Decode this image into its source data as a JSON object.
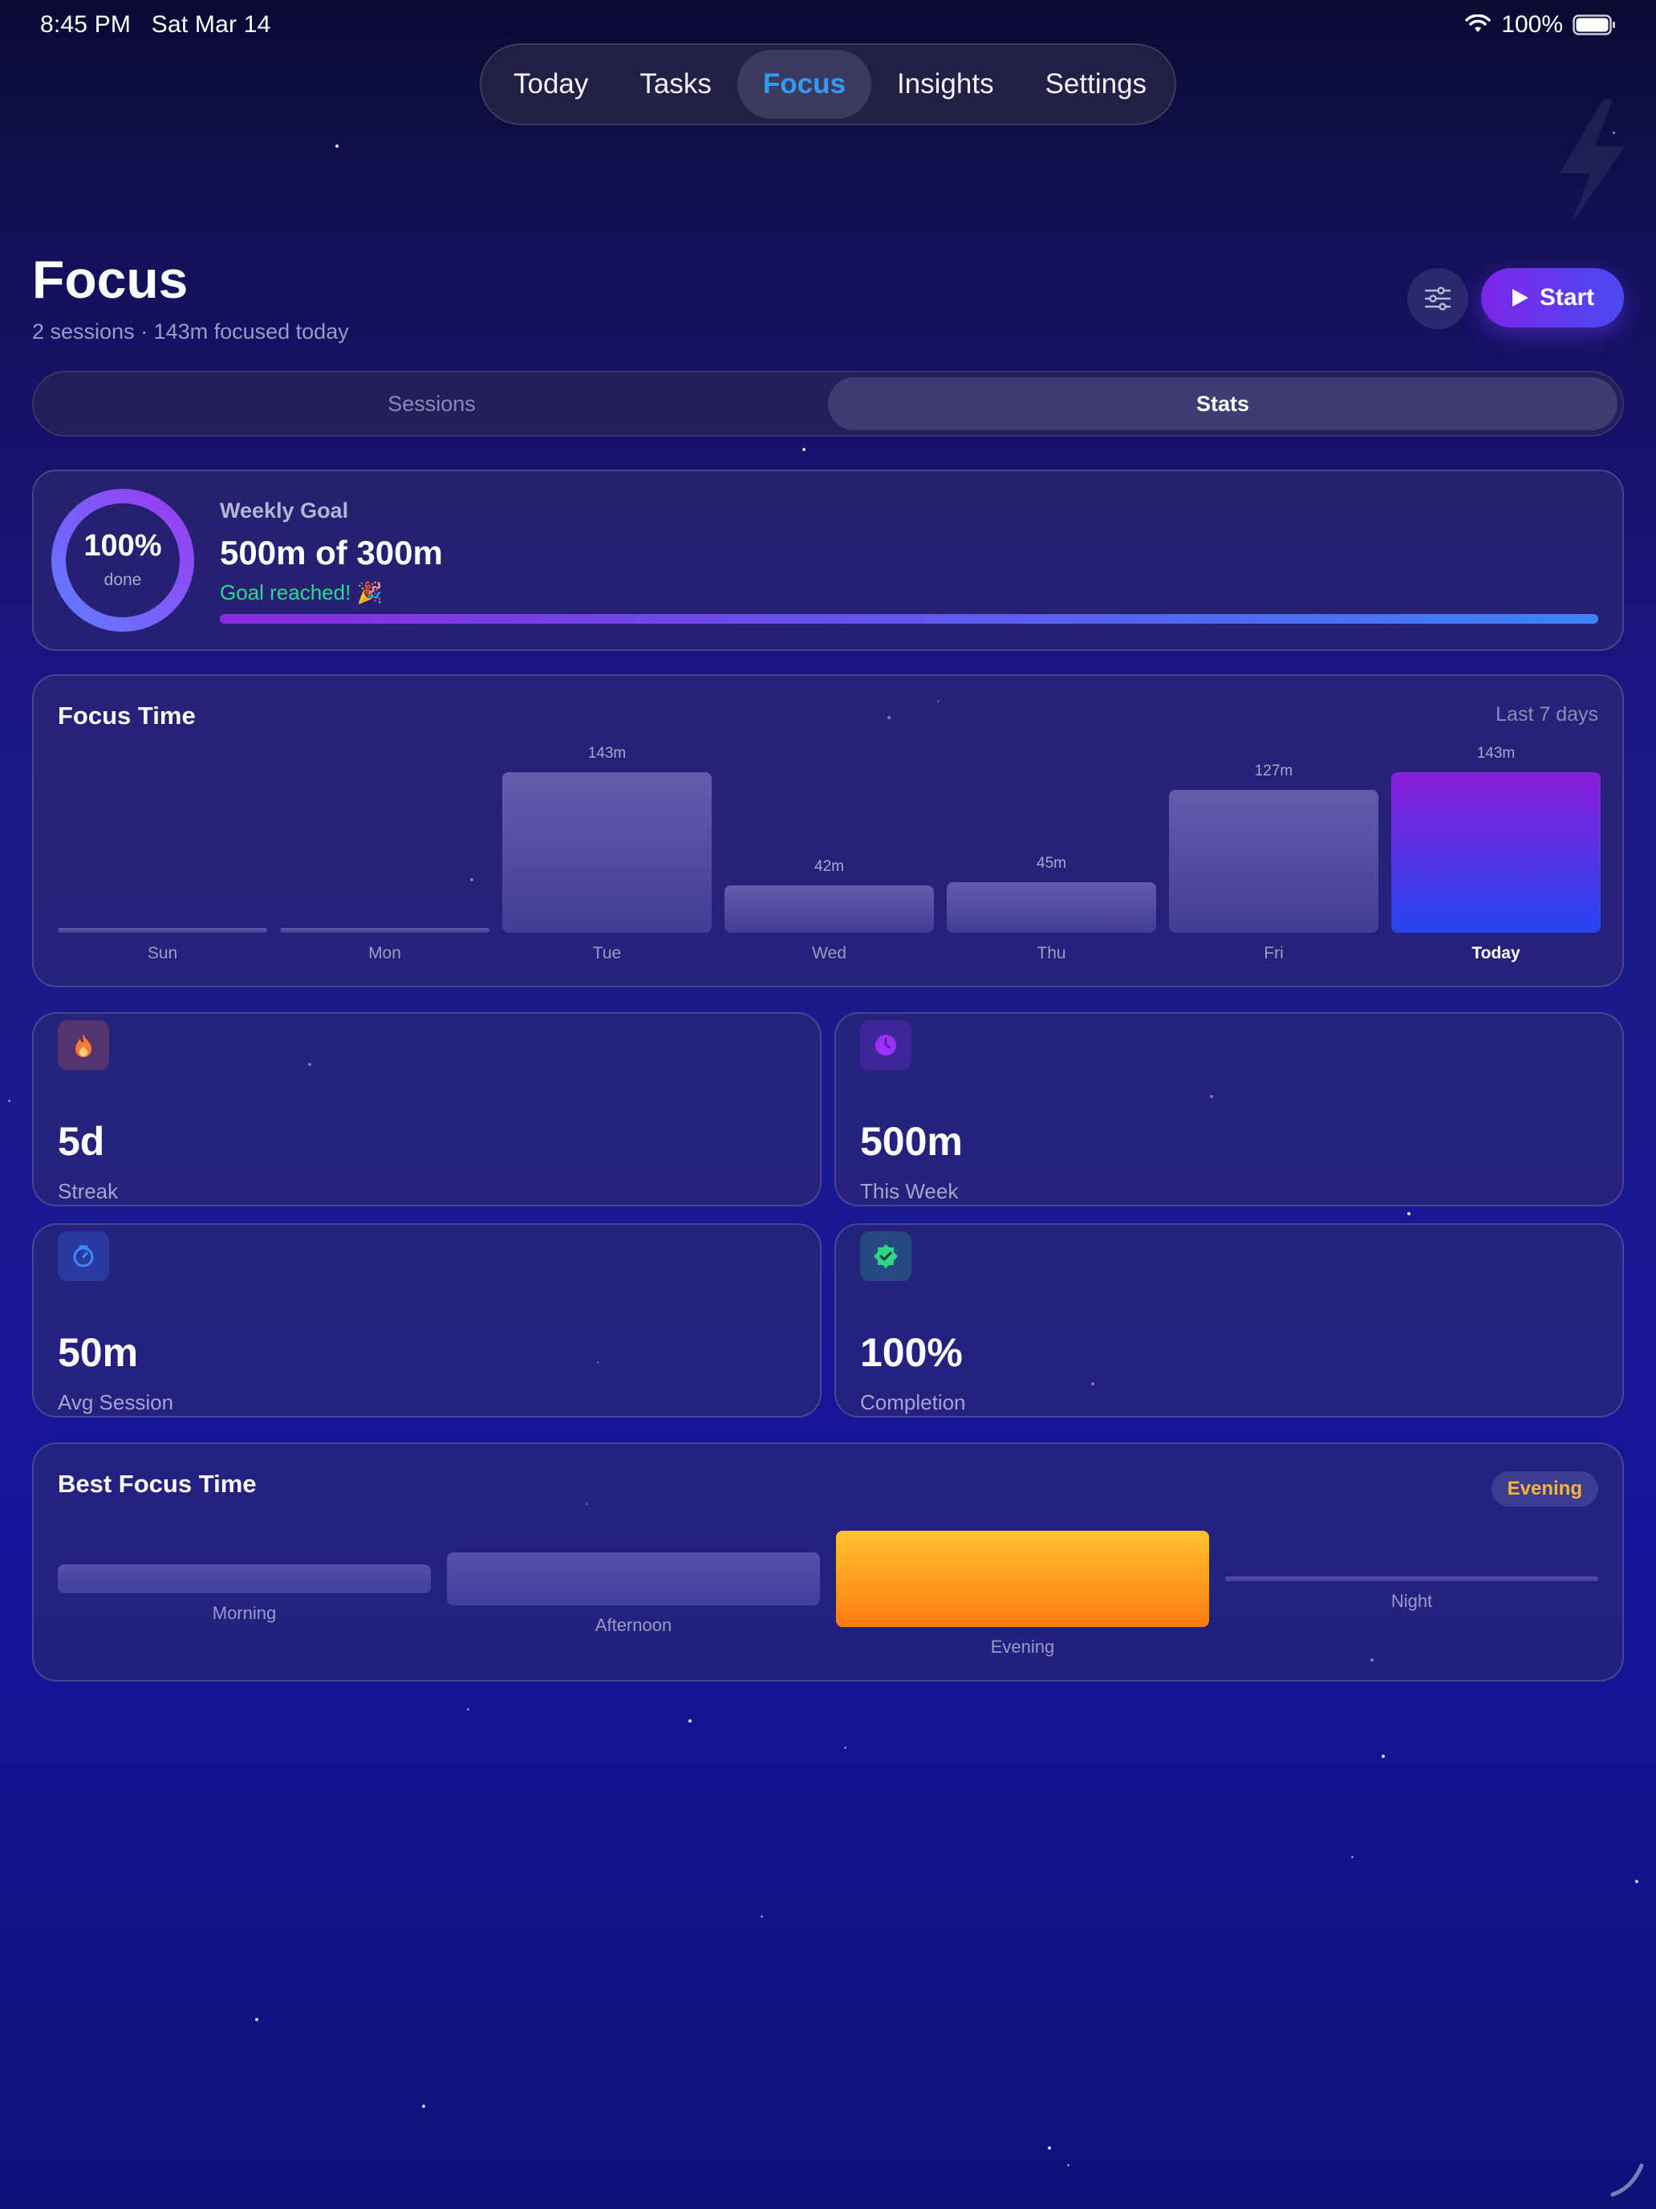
{
  "status": {
    "time": "8:45 PM",
    "date": "Sat Mar 14",
    "battery": "100%"
  },
  "nav": {
    "tabs": [
      "Today",
      "Tasks",
      "Focus",
      "Insights",
      "Settings"
    ],
    "active": "Focus"
  },
  "header": {
    "title": "Focus",
    "subtitle": "2 sessions · 143m focused today",
    "start_label": "Start"
  },
  "segment": {
    "items": [
      "Sessions",
      "Stats"
    ],
    "active": "Stats"
  },
  "weekly_goal": {
    "percent": "100%",
    "done_label": "done",
    "label": "Weekly Goal",
    "value": "500m of 300m",
    "message": "Goal reached! 🎉",
    "progress": 1.0
  },
  "focus_time": {
    "title": "Focus Time",
    "range": "Last 7 days",
    "days": [
      "Sun",
      "Mon",
      "Tue",
      "Wed",
      "Thu",
      "Fri",
      "Today"
    ],
    "minutes": [
      0,
      0,
      143,
      42,
      45,
      127,
      143
    ],
    "labels": [
      "",
      "",
      "143m",
      "42m",
      "45m",
      "127m",
      "143m"
    ]
  },
  "stats": [
    {
      "value": "5d",
      "label": "Streak",
      "icon": "flame-icon",
      "color": "#ff7a33"
    },
    {
      "value": "500m",
      "label": "This Week",
      "icon": "clock-icon",
      "color": "#9b30ff"
    },
    {
      "value": "50m",
      "label": "Avg Session",
      "icon": "timer-icon",
      "color": "#3d8bff"
    },
    {
      "value": "100%",
      "label": "Completion",
      "icon": "check-badge-icon",
      "color": "#2ed68a"
    }
  ],
  "best_focus": {
    "title": "Best Focus Time",
    "badge": "Evening",
    "periods": [
      "Morning",
      "Afternoon",
      "Evening",
      "Night"
    ],
    "levels": [
      0.3,
      0.55,
      1.0,
      0.05
    ],
    "best": "Evening"
  },
  "chart_data": {
    "type": "bar",
    "categories": [
      "Sun",
      "Mon",
      "Tue",
      "Wed",
      "Thu",
      "Fri",
      "Today"
    ],
    "values": [
      0,
      0,
      143,
      42,
      45,
      127,
      143
    ],
    "title": "Focus Time",
    "subtitle": "Last 7 days",
    "xlabel": "",
    "ylabel": "",
    "ylim": [
      0,
      143
    ],
    "grid": false
  }
}
